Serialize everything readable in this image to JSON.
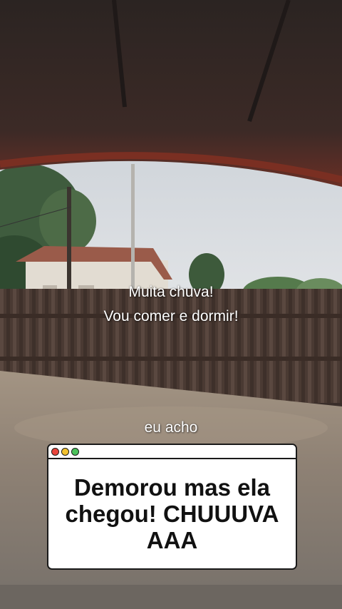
{
  "captions": {
    "line1": "Muita chuva!",
    "line2": "Vou comer e dormir!",
    "aside": "eu acho"
  },
  "popup": {
    "text": "Demorou mas ela chegou! CHUUUVA AAA"
  },
  "colors": {
    "roof_underside": "#3a2e2a",
    "sky": "#d9dde2",
    "fence": "#4a3a33",
    "ground": "#8a7d70",
    "popup_border": "#1a1a1a"
  }
}
